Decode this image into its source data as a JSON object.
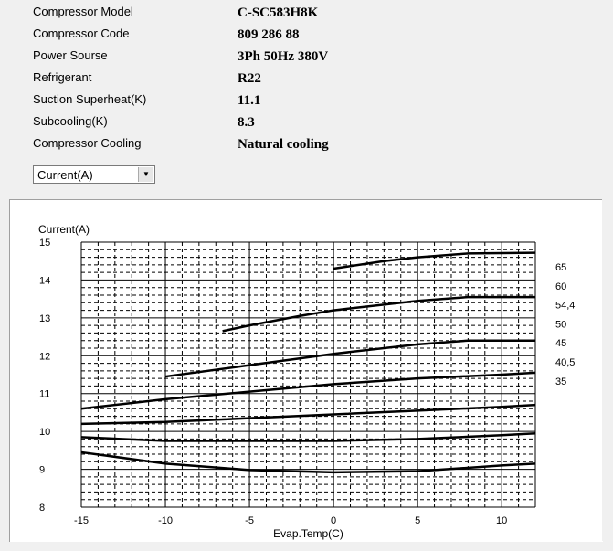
{
  "info": [
    {
      "label": "Compressor  Model",
      "value": "C-SC583H8K"
    },
    {
      "label": "Compressor Code",
      "value": "809 286 88"
    },
    {
      "label": "Power Sourse",
      "value": "3Ph  50Hz  380V"
    },
    {
      "label": "Refrigerant",
      "value": "R22"
    },
    {
      "label": "Suction Superheat(K)",
      "value": "11.1"
    },
    {
      "label": "Subcooling(K)",
      "value": "8.3"
    },
    {
      "label": "Compressor Cooling",
      "value": "Natural cooling"
    }
  ],
  "selector": {
    "value": "Current(A)",
    "icon": "chevron-down-icon"
  },
  "chart_data": {
    "type": "line",
    "ylabel": "Current(A)",
    "xlabel": "Evap.Temp(C)",
    "xlim": [
      -15,
      12
    ],
    "ylim": [
      8,
      15
    ],
    "xticks": [
      -15,
      -10,
      -5,
      0,
      5,
      10
    ],
    "yticks": [
      8,
      9,
      10,
      11,
      12,
      13,
      14,
      15
    ],
    "grid": true,
    "legend_labels": [
      "65",
      "60",
      "54,4",
      "50",
      "45",
      "40,5",
      "35"
    ],
    "series": [
      {
        "points": [
          [
            0,
            14.3
          ],
          [
            3,
            14.5
          ],
          [
            5,
            14.6
          ],
          [
            8,
            14.7
          ],
          [
            12,
            14.72
          ]
        ]
      },
      {
        "points": [
          [
            -6.6,
            12.65
          ],
          [
            -5,
            12.8
          ],
          [
            -2,
            13.05
          ],
          [
            0,
            13.2
          ],
          [
            5,
            13.45
          ],
          [
            8,
            13.55
          ],
          [
            12,
            13.55
          ]
        ]
      },
      {
        "points": [
          [
            -10,
            11.45
          ],
          [
            -5,
            11.75
          ],
          [
            0,
            12.05
          ],
          [
            5,
            12.3
          ],
          [
            8,
            12.4
          ],
          [
            12,
            12.4
          ]
        ]
      },
      {
        "points": [
          [
            -15,
            10.6
          ],
          [
            -10,
            10.85
          ],
          [
            -5,
            11.05
          ],
          [
            0,
            11.25
          ],
          [
            5,
            11.4
          ],
          [
            10,
            11.5
          ],
          [
            12,
            11.55
          ]
        ]
      },
      {
        "points": [
          [
            -15,
            10.2
          ],
          [
            -10,
            10.25
          ],
          [
            -5,
            10.35
          ],
          [
            0,
            10.45
          ],
          [
            5,
            10.55
          ],
          [
            10,
            10.65
          ],
          [
            12,
            10.7
          ]
        ]
      },
      {
        "points": [
          [
            -15,
            9.85
          ],
          [
            -10,
            9.75
          ],
          [
            -5,
            9.75
          ],
          [
            0,
            9.75
          ],
          [
            5,
            9.8
          ],
          [
            10,
            9.9
          ],
          [
            12,
            9.95
          ]
        ]
      },
      {
        "points": [
          [
            -15,
            9.45
          ],
          [
            -10,
            9.15
          ],
          [
            -5,
            8.98
          ],
          [
            0,
            8.92
          ],
          [
            5,
            8.95
          ],
          [
            10,
            9.1
          ],
          [
            12,
            9.15
          ]
        ]
      }
    ]
  }
}
